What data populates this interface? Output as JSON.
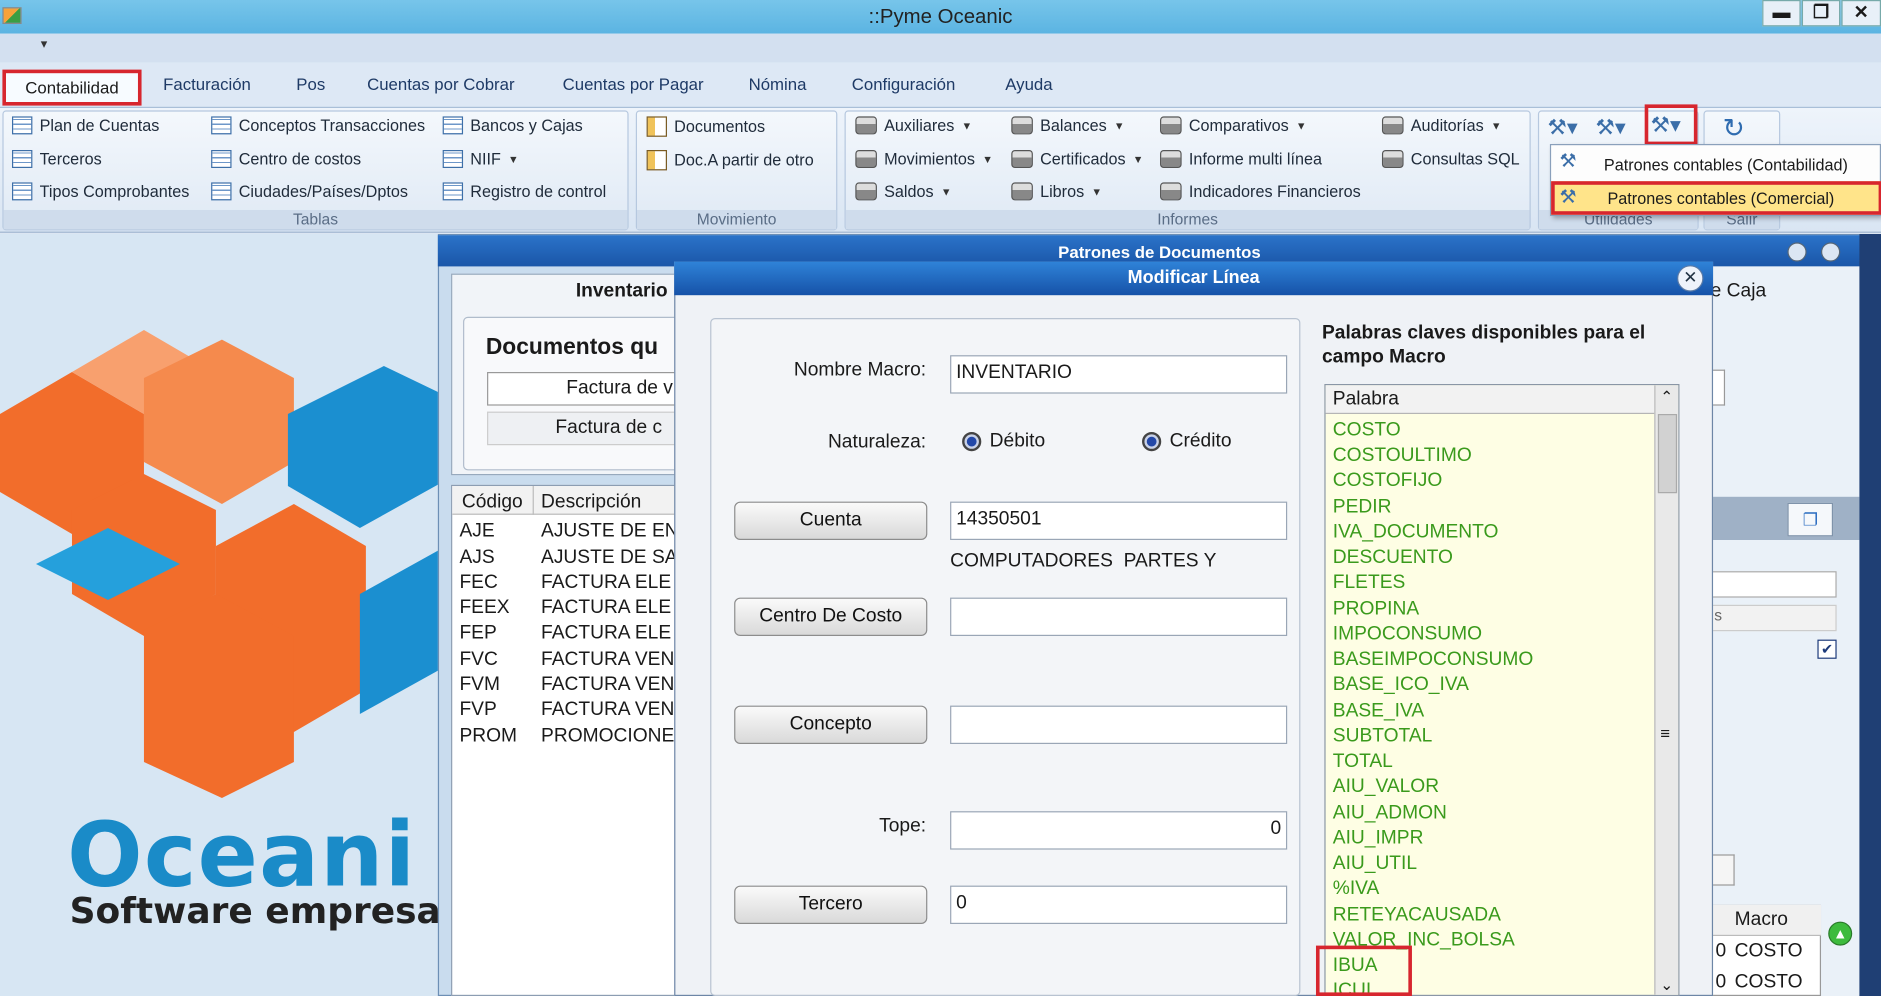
{
  "window": {
    "title": "::Pyme Oceanic",
    "minimize": "▬",
    "restore": "❐",
    "close": "✕"
  },
  "quickbar": {
    "arrow": "▾"
  },
  "menu": {
    "tabs": [
      "Contabilidad",
      "Facturación",
      "Pos",
      "Cuentas por Cobrar",
      "Cuentas por Pagar",
      "Nómina",
      "Configuración",
      "Ayuda"
    ]
  },
  "ribbon": {
    "tablas": {
      "label": "Tablas",
      "items": [
        "Plan de Cuentas",
        "Conceptos Transacciones",
        "Bancos y Cajas",
        "Terceros",
        "Centro de costos",
        "NIIF",
        "Tipos Comprobantes",
        "Ciudades/Países/Dptos",
        "Registro de control"
      ]
    },
    "movimiento": {
      "label": "Movimiento",
      "items": [
        "Documentos",
        "Doc.A partir de otro"
      ]
    },
    "informes": {
      "label": "Informes",
      "items": [
        "Auxiliares",
        "Balances",
        "Comparativos",
        "Auditorías",
        "Movimientos",
        "Certificados",
        "Informe multi línea",
        "Consultas SQL",
        "Saldos",
        "Libros",
        "Indicadores Financieros"
      ]
    },
    "utilidades": {
      "label": "Utilidades"
    },
    "salir": {
      "label": "Salir"
    }
  },
  "util_menu": {
    "items": [
      "Patrones contables (Contabilidad)",
      "Patrones contables (Comercial)"
    ]
  },
  "logo": {
    "name": "Oceani",
    "tagline": "Software empresa"
  },
  "patrones": {
    "title": "Patrones de Documentos",
    "tab": "Inventario",
    "heading": "Documentos qu",
    "buttons": [
      "Factura de v",
      "Factura de c"
    ],
    "right_tab": "e Caja",
    "list_headers": [
      "Código",
      "Descripción"
    ],
    "rows": [
      [
        "AJE",
        "AJUSTE DE EN"
      ],
      [
        "AJS",
        "AJUSTE DE SA"
      ],
      [
        "FEC",
        "FACTURA ELE"
      ],
      [
        "FEEX",
        "FACTURA ELE"
      ],
      [
        "FEP",
        "FACTURA ELE"
      ],
      [
        "FVC",
        "FACTURA VEN"
      ],
      [
        "FVM",
        "FACTURA VEN"
      ],
      [
        "FVP",
        "FACTURA VEN"
      ],
      [
        "PROM",
        "PROMOCIONE"
      ]
    ],
    "grid_header": "Macro",
    "grid_rows": [
      [
        "0",
        "COSTO"
      ],
      [
        "0",
        "COSTO"
      ]
    ],
    "small_letter": "s"
  },
  "dialog": {
    "title": "Modificar Línea",
    "close": "✕",
    "nombre_macro_label": "Nombre Macro:",
    "nombre_macro": "INVENTARIO",
    "naturaleza_label": "Naturaleza:",
    "debito": "Débito",
    "credito": "Crédito",
    "cuenta_button": "Cuenta",
    "cuenta_value": "14350501",
    "cuenta_desc": "COMPUTADORES  PARTES Y",
    "centro_button": "Centro De Costo",
    "centro_value": "",
    "concepto_button": "Concepto",
    "concepto_value": "",
    "tope_label": "Tope:",
    "tope_value": "0",
    "tercero_button": "Tercero",
    "tercero_value": "0",
    "keywords_title": "Palabras claves disponibles para el campo Macro",
    "keywords_header": "Palabra",
    "keywords": [
      "COSTO",
      "COSTOULTIMO",
      "COSTOFIJO",
      "PEDIR",
      "IVA_DOCUMENTO",
      "DESCUENTO",
      "FLETES",
      "PROPINA",
      "IMPOCONSUMO",
      "BASEIMPOCONSUMO",
      "BASE_ICO_IVA",
      "BASE_IVA",
      "SUBTOTAL",
      "TOTAL",
      "AIU_VALOR",
      "AIU_ADMON",
      "AIU_IMPR",
      "AIU_UTIL",
      "%IVA",
      "RETEYACAUSADA",
      "VALOR_INC_BOLSA",
      "IBUA",
      "ICUI"
    ],
    "scroll_up": "⌃",
    "scroll_mid": "≡",
    "scroll_down": "⌄"
  },
  "colors": {
    "accent_red": "#d7262e",
    "keyword_green": "#3a9a1c",
    "title_blue": "#1652a8"
  }
}
